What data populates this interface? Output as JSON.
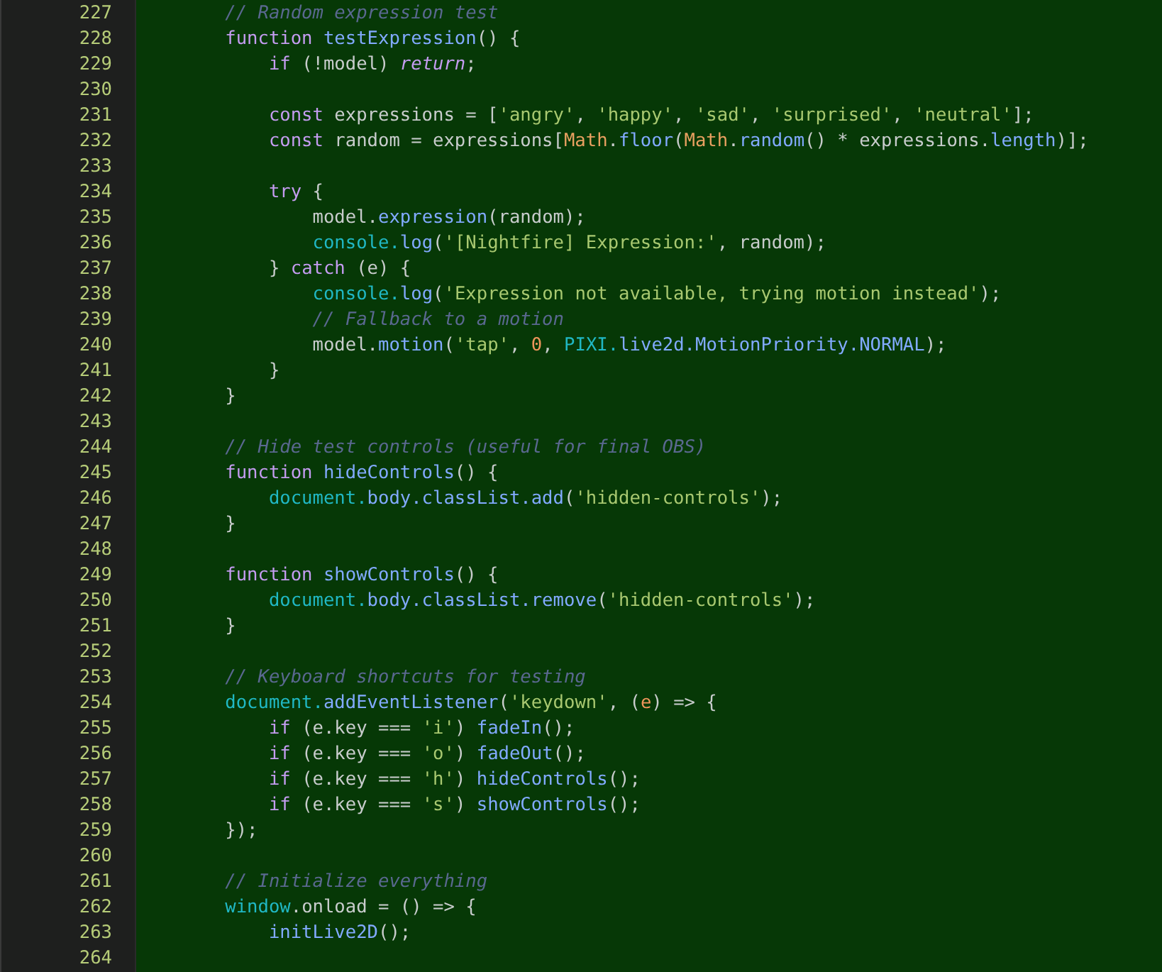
{
  "editor": {
    "lines": [
      {
        "number": "227",
        "tokens": [
          {
            "kind": "comment",
            "text": "        // Random expression test"
          }
        ]
      },
      {
        "number": "228",
        "tokens": [
          {
            "kind": "keyword",
            "text": "        function "
          },
          {
            "kind": "function",
            "text": "testExpression"
          },
          {
            "kind": "plain",
            "text": "() {"
          }
        ]
      },
      {
        "number": "229",
        "tokens": [
          {
            "kind": "keyword",
            "text": "            if"
          },
          {
            "kind": "plain",
            "text": " (!model) "
          },
          {
            "kind": "keyword_italic",
            "text": "return"
          },
          {
            "kind": "plain",
            "text": ";"
          }
        ]
      },
      {
        "number": "230"
      },
      {
        "number": "231",
        "tokens": [
          {
            "kind": "keyword",
            "text": "            const"
          },
          {
            "kind": "plain",
            "text": " expressions = ["
          },
          {
            "kind": "string",
            "text": "'angry'"
          },
          {
            "kind": "plain",
            "text": ", "
          },
          {
            "kind": "string",
            "text": "'happy'"
          },
          {
            "kind": "plain",
            "text": ", "
          },
          {
            "kind": "string",
            "text": "'sad'"
          },
          {
            "kind": "plain",
            "text": ", "
          },
          {
            "kind": "string",
            "text": "'surprised'"
          },
          {
            "kind": "plain",
            "text": ", "
          },
          {
            "kind": "string",
            "text": "'neutral'"
          },
          {
            "kind": "plain",
            "text": "];"
          }
        ]
      },
      {
        "number": "232",
        "tokens": [
          {
            "kind": "keyword",
            "text": "            const"
          },
          {
            "kind": "plain",
            "text": " random = expressions["
          },
          {
            "kind": "class",
            "text": "Math"
          },
          {
            "kind": "plain",
            "text": "."
          },
          {
            "kind": "function",
            "text": "floor"
          },
          {
            "kind": "plain",
            "text": "("
          },
          {
            "kind": "class",
            "text": "Math"
          },
          {
            "kind": "plain",
            "text": "."
          },
          {
            "kind": "function",
            "text": "random"
          },
          {
            "kind": "plain",
            "text": "() * expressions."
          },
          {
            "kind": "function",
            "text": "length"
          },
          {
            "kind": "plain",
            "text": ")];"
          }
        ]
      },
      {
        "number": "233"
      },
      {
        "number": "234",
        "tokens": [
          {
            "kind": "keyword",
            "text": "            try"
          },
          {
            "kind": "plain",
            "text": " {"
          }
        ]
      },
      {
        "number": "235",
        "tokens": [
          {
            "kind": "plain",
            "text": "                model."
          },
          {
            "kind": "function",
            "text": "expression"
          },
          {
            "kind": "plain",
            "text": "(random);"
          }
        ]
      },
      {
        "number": "236",
        "tokens": [
          {
            "kind": "global",
            "text": "                console."
          },
          {
            "kind": "function",
            "text": "log"
          },
          {
            "kind": "plain",
            "text": "("
          },
          {
            "kind": "string",
            "text": "'[Nightfire] Expression:'"
          },
          {
            "kind": "plain",
            "text": ", random);"
          }
        ]
      },
      {
        "number": "237",
        "tokens": [
          {
            "kind": "plain",
            "text": "            } "
          },
          {
            "kind": "keyword",
            "text": "catch"
          },
          {
            "kind": "plain",
            "text": " (e) {"
          }
        ]
      },
      {
        "number": "238",
        "tokens": [
          {
            "kind": "global",
            "text": "                console."
          },
          {
            "kind": "function",
            "text": "log"
          },
          {
            "kind": "plain",
            "text": "("
          },
          {
            "kind": "string",
            "text": "'Expression not available, trying motion instead'"
          },
          {
            "kind": "plain",
            "text": ");"
          }
        ]
      },
      {
        "number": "239",
        "tokens": [
          {
            "kind": "comment",
            "text": "                // Fallback to a motion"
          }
        ]
      },
      {
        "number": "240",
        "tokens": [
          {
            "kind": "plain",
            "text": "                model."
          },
          {
            "kind": "function",
            "text": "motion"
          },
          {
            "kind": "plain",
            "text": "("
          },
          {
            "kind": "string",
            "text": "'tap'"
          },
          {
            "kind": "plain",
            "text": ", "
          },
          {
            "kind": "number",
            "text": "0"
          },
          {
            "kind": "plain",
            "text": ", "
          },
          {
            "kind": "global",
            "text": "PIXI."
          },
          {
            "kind": "function",
            "text": "live2d.MotionPriority.NORMAL"
          },
          {
            "kind": "plain",
            "text": ");"
          }
        ]
      },
      {
        "number": "241",
        "tokens": [
          {
            "kind": "plain",
            "text": "            }"
          }
        ]
      },
      {
        "number": "242",
        "tokens": [
          {
            "kind": "plain",
            "text": "        }"
          }
        ]
      },
      {
        "number": "243"
      },
      {
        "number": "244",
        "tokens": [
          {
            "kind": "comment",
            "text": "        // Hide test controls (useful for final OBS)"
          }
        ]
      },
      {
        "number": "245",
        "tokens": [
          {
            "kind": "keyword",
            "text": "        function "
          },
          {
            "kind": "function",
            "text": "hideControls"
          },
          {
            "kind": "plain",
            "text": "() {"
          }
        ]
      },
      {
        "number": "246",
        "tokens": [
          {
            "kind": "global",
            "text": "            document."
          },
          {
            "kind": "function",
            "text": "body.classList.add"
          },
          {
            "kind": "plain",
            "text": "("
          },
          {
            "kind": "string",
            "text": "'hidden-controls'"
          },
          {
            "kind": "plain",
            "text": ");"
          }
        ]
      },
      {
        "number": "247",
        "tokens": [
          {
            "kind": "plain",
            "text": "        }"
          }
        ]
      },
      {
        "number": "248"
      },
      {
        "number": "249",
        "tokens": [
          {
            "kind": "keyword",
            "text": "        function "
          },
          {
            "kind": "function",
            "text": "showControls"
          },
          {
            "kind": "plain",
            "text": "() {"
          }
        ]
      },
      {
        "number": "250",
        "tokens": [
          {
            "kind": "global",
            "text": "            document."
          },
          {
            "kind": "function",
            "text": "body.classList.remove"
          },
          {
            "kind": "plain",
            "text": "("
          },
          {
            "kind": "string",
            "text": "'hidden-controls'"
          },
          {
            "kind": "plain",
            "text": ");"
          }
        ]
      },
      {
        "number": "251",
        "tokens": [
          {
            "kind": "plain",
            "text": "        }"
          }
        ]
      },
      {
        "number": "252"
      },
      {
        "number": "253",
        "tokens": [
          {
            "kind": "comment",
            "text": "        // Keyboard shortcuts for testing"
          }
        ]
      },
      {
        "number": "254",
        "tokens": [
          {
            "kind": "global",
            "text": "        document."
          },
          {
            "kind": "function",
            "text": "addEventListener"
          },
          {
            "kind": "plain",
            "text": "("
          },
          {
            "kind": "string",
            "text": "'keydown'"
          },
          {
            "kind": "plain",
            "text": ", ("
          },
          {
            "kind": "number",
            "text": "e"
          },
          {
            "kind": "plain",
            "text": ") => {"
          }
        ]
      },
      {
        "number": "255",
        "tokens": [
          {
            "kind": "keyword",
            "text": "            if"
          },
          {
            "kind": "plain",
            "text": " (e.key === "
          },
          {
            "kind": "string",
            "text": "'i'"
          },
          {
            "kind": "plain",
            "text": ") "
          },
          {
            "kind": "function",
            "text": "fadeIn"
          },
          {
            "kind": "plain",
            "text": "();"
          }
        ]
      },
      {
        "number": "256",
        "tokens": [
          {
            "kind": "keyword",
            "text": "            if"
          },
          {
            "kind": "plain",
            "text": " (e.key === "
          },
          {
            "kind": "string",
            "text": "'o'"
          },
          {
            "kind": "plain",
            "text": ") "
          },
          {
            "kind": "function",
            "text": "fadeOut"
          },
          {
            "kind": "plain",
            "text": "();"
          }
        ]
      },
      {
        "number": "257",
        "tokens": [
          {
            "kind": "keyword",
            "text": "            if"
          },
          {
            "kind": "plain",
            "text": " (e.key === "
          },
          {
            "kind": "string",
            "text": "'h'"
          },
          {
            "kind": "plain",
            "text": ") "
          },
          {
            "kind": "function",
            "text": "hideControls"
          },
          {
            "kind": "plain",
            "text": "();"
          }
        ]
      },
      {
        "number": "258",
        "tokens": [
          {
            "kind": "keyword",
            "text": "            if"
          },
          {
            "kind": "plain",
            "text": " (e.key === "
          },
          {
            "kind": "string",
            "text": "'s'"
          },
          {
            "kind": "plain",
            "text": ") "
          },
          {
            "kind": "function",
            "text": "showControls"
          },
          {
            "kind": "plain",
            "text": "();"
          }
        ]
      },
      {
        "number": "259",
        "tokens": [
          {
            "kind": "plain",
            "text": "        });"
          }
        ]
      },
      {
        "number": "260"
      },
      {
        "number": "261",
        "tokens": [
          {
            "kind": "comment",
            "text": "        // Initialize everything"
          }
        ]
      },
      {
        "number": "262",
        "tokens": [
          {
            "kind": "global",
            "text": "        window"
          },
          {
            "kind": "plain",
            "text": ".onload = () => {"
          }
        ]
      },
      {
        "number": "263",
        "tokens": [
          {
            "kind": "function",
            "text": "            initLive2D"
          },
          {
            "kind": "plain",
            "text": "();"
          }
        ]
      },
      {
        "number": "264"
      }
    ]
  }
}
